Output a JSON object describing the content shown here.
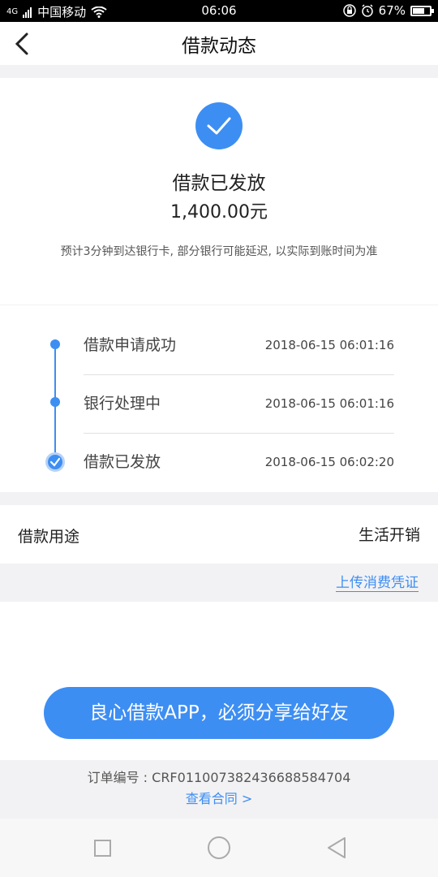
{
  "status_bar": {
    "carrier": "中国移动",
    "time": "06:06",
    "battery": "67%",
    "signal_label": "4G"
  },
  "nav": {
    "title": "借款动态"
  },
  "result": {
    "title": "借款已发放",
    "amount": "1,400.00元",
    "notice": "预计3分钟到达银行卡, 部分银行可能延迟, 以实际到账时间为准"
  },
  "timeline": [
    {
      "name": "借款申请成功",
      "time": "2018-06-15 06:01:16"
    },
    {
      "name": "银行处理中",
      "time": "2018-06-15 06:01:16"
    },
    {
      "name": "借款已发放",
      "time": "2018-06-15 06:02:20"
    }
  ],
  "purpose": {
    "label": "借款用途",
    "value": "生活开销"
  },
  "upload_link": "上传消费凭证",
  "share_button": "良心借款APP，必须分享给好友",
  "order": {
    "text": "订单编号 : CRF011007382436688584704",
    "contract_link": "查看合同 >"
  },
  "colors": {
    "accent": "#3d8ef3",
    "background": "#f2f2f4"
  },
  "icons": [
    "back-arrow-icon",
    "check-circle-icon",
    "wifi-icon",
    "alarm-icon",
    "lock-icon",
    "battery-icon"
  ]
}
